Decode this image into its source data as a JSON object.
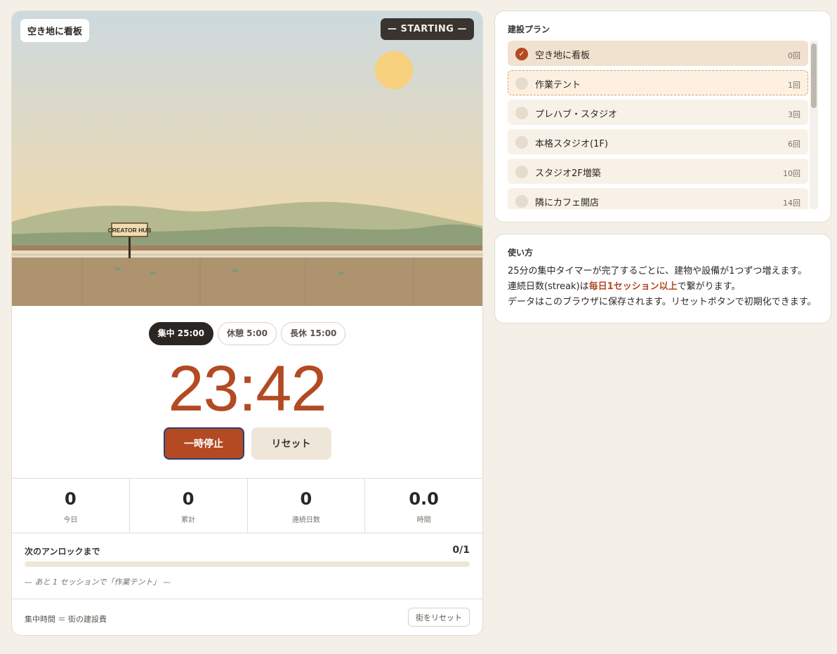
{
  "scene": {
    "stage_label": "空き地に看板",
    "status_label": "— STARTING —",
    "sign_text": "CREATOR HUB",
    "colors": {
      "sky_top": "#cdd9df",
      "sky_bottom": "#f1d9a8",
      "sun": "#f7d07d",
      "hill_back": "#b5b98f",
      "hill_front": "#8f9f79",
      "ground": "#ae936f"
    }
  },
  "modes": [
    {
      "label": "集中 25:00",
      "active": true
    },
    {
      "label": "休憩 5:00",
      "active": false
    },
    {
      "label": "長休 15:00",
      "active": false
    }
  ],
  "timer": {
    "display": "23:42"
  },
  "controls": {
    "pause_label": "一時停止",
    "reset_label": "リセット"
  },
  "stats": [
    {
      "value": "0",
      "label": "今日"
    },
    {
      "value": "0",
      "label": "累計"
    },
    {
      "value": "0",
      "label": "連続日数"
    },
    {
      "value": "0.0",
      "label": "時間"
    }
  ],
  "progress": {
    "title": "次のアンロックまで",
    "count": "0/1",
    "fraction": 0,
    "hint": "— あと 1 セッションで「作業テント」 —"
  },
  "footer": {
    "note": "集中時間 ＝ 街の建設費",
    "reset_city_label": "街をリセット"
  },
  "plan": {
    "title": "建設プラン",
    "items": [
      {
        "name": "空き地に看板",
        "cost": "0回",
        "state": "done"
      },
      {
        "name": "作業テント",
        "cost": "1回",
        "state": "next"
      },
      {
        "name": "プレハブ・スタジオ",
        "cost": "3回",
        "state": "locked"
      },
      {
        "name": "本格スタジオ(1F)",
        "cost": "6回",
        "state": "locked"
      },
      {
        "name": "スタジオ2F増築",
        "cost": "10回",
        "state": "locked"
      },
      {
        "name": "隣にカフェ開店",
        "cost": "14回",
        "state": "locked"
      }
    ]
  },
  "howto": {
    "title": "使い方",
    "line1": "25分の集中タイマーが完了するごとに、建物や設備が1つずつ増えます。",
    "line2_prefix": "連続日数(streak)は",
    "line2_emphasis": "毎日1セッション以上",
    "line2_suffix": "で繋がります。",
    "line3": "データはこのブラウザに保存されます。リセットボタンで初期化できます。"
  },
  "accent_color": "#b34a22"
}
